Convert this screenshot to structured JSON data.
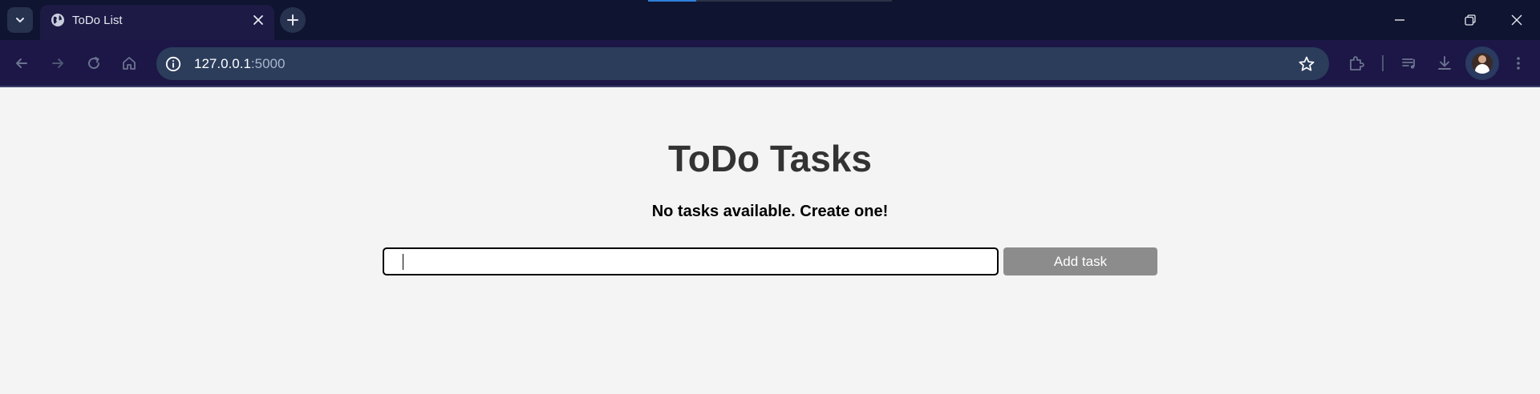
{
  "browser": {
    "tab": {
      "title": "ToDo List"
    },
    "omnibox": {
      "host": "127.0.0.1",
      "port": ":5000"
    },
    "colors": {
      "titlebar": "#0f1430",
      "toolbar": "#1c1747",
      "omnibox": "#2c3d5c"
    }
  },
  "page": {
    "heading": "ToDo Tasks",
    "empty_message": "No tasks available. Create one!",
    "task_input": {
      "value": "",
      "placeholder": ""
    },
    "add_button_label": "Add task",
    "colors": {
      "background": "#f4f4f4",
      "button": "#8c8c8c",
      "heading": "#333333"
    }
  },
  "icons": [
    "tab-search-icon",
    "globe-icon",
    "close-icon",
    "plus-icon",
    "minimize-icon",
    "restore-icon",
    "window-close-icon",
    "back-arrow-icon",
    "forward-arrow-icon",
    "reload-icon",
    "home-icon",
    "site-info-icon",
    "bookmark-star-icon",
    "extensions-icon",
    "media-control-icon",
    "download-icon",
    "profile-avatar",
    "menu-kebab-icon"
  ]
}
